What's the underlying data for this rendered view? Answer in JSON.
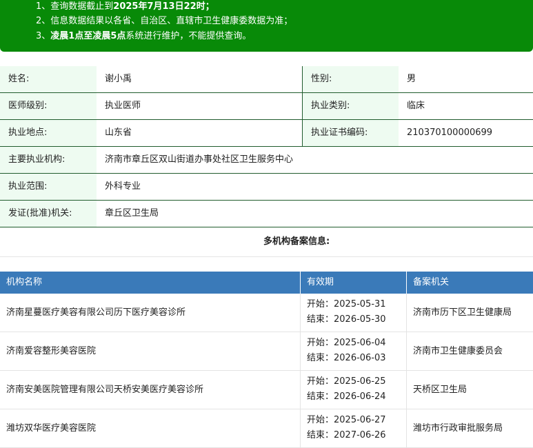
{
  "notice": {
    "line1_prefix": "1、查询数据截止到",
    "line1_bold": "2025年7月13日22时",
    "line1_suffix": "；",
    "line2": "2、信息数据结果以各省、自治区、直辖市卫生健康委数据为准；",
    "line3_prefix": "3、",
    "line3_bold": "凌晨1点至凌晨5点",
    "line3_suffix": "系统进行维护，不能提供查询。",
    "bg_color": "#088a08"
  },
  "info": {
    "name_label": "姓名:",
    "name_value": "谢小禹",
    "gender_label": "性别:",
    "gender_value": "男",
    "level_label": "医师级别:",
    "level_value": "执业医师",
    "category_label": "执业类别:",
    "category_value": "临床",
    "location_label": "执业地点:",
    "location_value": "山东省",
    "cert_label": "执业证书编码:",
    "cert_value": "210370100000699",
    "main_org_label": "主要执业机构:",
    "main_org_value": "济南市章丘区双山街道办事处社区卫生服务中心",
    "scope_label": "执业范围:",
    "scope_value": "外科专业",
    "issuer_label": "发证(批准)机关:",
    "issuer_value": "章丘区卫生局"
  },
  "multi": {
    "title": "多机构备案信息:",
    "headers": [
      "机构名称",
      "有效期",
      "备案机关"
    ],
    "header_color": "#3a7ab9",
    "rows": [
      {
        "name": "济南星蔓医疗美容有限公司历下医疗美容诊所",
        "start": "开始：2025-05-31",
        "end": "结束：2026-05-30",
        "org": "济南市历下区卫生健康局"
      },
      {
        "name": "济南爱容整形美容医院",
        "start": "开始：2025-06-04",
        "end": "结束：2026-06-03",
        "org": "济南市卫生健康委员会"
      },
      {
        "name": "济南安美医院管理有限公司天桥安美医疗美容诊所",
        "start": "开始：2025-06-25",
        "end": "结束：2026-06-24",
        "org": "天桥区卫生局"
      },
      {
        "name": "潍坊双华医疗美容医院",
        "start": "开始：2025-06-27",
        "end": "结束：2027-06-26",
        "org": "潍坊市行政审批服务局"
      }
    ]
  }
}
